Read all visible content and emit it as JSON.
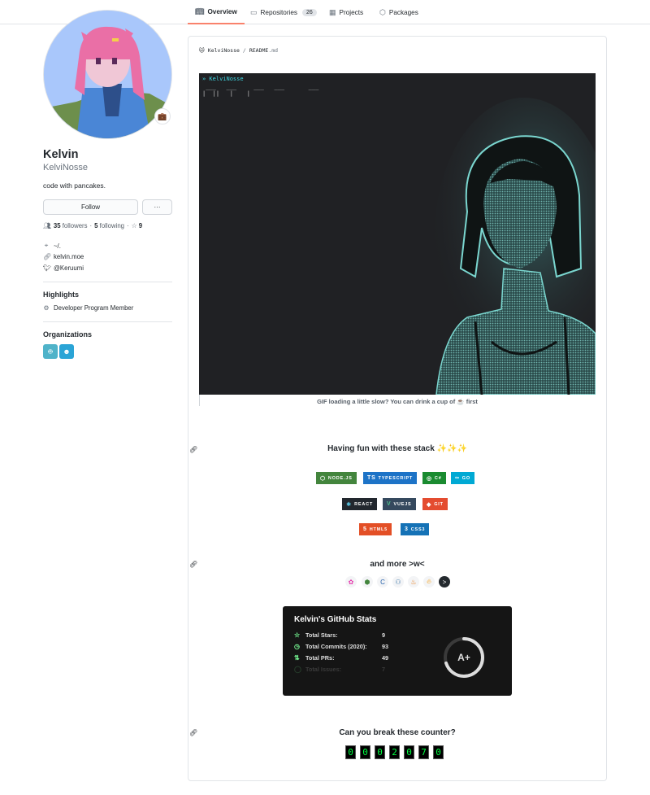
{
  "nav": {
    "tabs": [
      {
        "label": "Overview",
        "icon": "book-icon",
        "active": true
      },
      {
        "label": "Repositories",
        "icon": "repo-icon",
        "count": "26"
      },
      {
        "label": "Projects",
        "icon": "project-icon"
      },
      {
        "label": "Packages",
        "icon": "package-icon"
      }
    ]
  },
  "profile": {
    "name": "Kelvin",
    "login": "KelviNosse",
    "bio": "code with pancakes.",
    "follow_label": "Follow",
    "more_label": "···",
    "followers_count": "35",
    "followers_label": "followers",
    "following_count": "5",
    "following_label": "following",
    "stars_count": "9",
    "location": "~/.",
    "website": "kelvin.moe",
    "twitter": "@Keruumi",
    "status_icon": "briefcase-emoji"
  },
  "highlights": {
    "title": "Highlights",
    "items": [
      {
        "label": "Developer Program Member",
        "icon": "cpu-icon"
      }
    ]
  },
  "organizations": {
    "title": "Organizations",
    "items": [
      {
        "icon": "robot-org-icon",
        "color": "#4fb3c9"
      },
      {
        "icon": "face-org-icon",
        "color": "#2aa4d6"
      }
    ]
  },
  "readme": {
    "path_owner": "KelviNosse",
    "path_sep": "/",
    "path_file": "README",
    "path_ext": ".md",
    "terminal_title": "» KelviNosse",
    "terminal_art": " ___   ___     ___   ___       ___\n|  ||   |    |",
    "caption": "GIF loading a little slow? You can drink a cup of ☕ first",
    "section_stack_title": "Having fun with these stack ✨✨✨",
    "section_more_title": "and more >w<",
    "section_counter_title": "Can you break these counter?",
    "badges": [
      {
        "label": "NODE.JS",
        "color": "#43853d",
        "icon": "nodejs-icon",
        "glyph": "⬡"
      },
      {
        "label": "TYPESCRIPT",
        "color": "#1d73c7",
        "icon": "typescript-icon",
        "glyph": "TS"
      },
      {
        "label": "C#",
        "color": "#1a8b30",
        "icon": "csharp-icon",
        "glyph": "◎"
      },
      {
        "label": "GO",
        "color": "#00a9d4",
        "icon": "go-icon",
        "glyph": "∞"
      },
      {
        "label": "REACT",
        "color": "#22272e",
        "icon": "react-icon",
        "glyph": "⚛"
      },
      {
        "label": "VUEJS",
        "color": "#35495e",
        "icon": "vue-icon",
        "glyph": "V"
      },
      {
        "label": "GIT",
        "color": "#e44c30",
        "icon": "git-icon",
        "glyph": "◆"
      },
      {
        "label": "HTML5",
        "color": "#e34f26",
        "icon": "html5-icon",
        "glyph": "5"
      },
      {
        "label": "CSS3",
        "color": "#1572b6",
        "icon": "css3-icon",
        "glyph": "3"
      }
    ],
    "tech_icons": [
      "graphql-icon",
      "nodejs-icon",
      "c-lang-icon",
      "python-icon",
      "java-icon",
      "firebase-icon",
      "terminal-icon"
    ],
    "stats_card": {
      "title": "Kelvin's GitHub Stats",
      "rows": [
        {
          "label": "Total Stars:",
          "value": "9",
          "icon": "star-icon"
        },
        {
          "label": "Total Commits (2020):",
          "value": "93",
          "icon": "history-icon"
        },
        {
          "label": "Total PRs:",
          "value": "49",
          "icon": "pr-icon"
        },
        {
          "label": "Total Issues:",
          "value": "7",
          "icon": "issue-icon"
        }
      ],
      "rank": "A+",
      "rank_progress": 0.7
    },
    "counter_digits": [
      "0",
      "0",
      "0",
      "2",
      "0",
      "7",
      "0"
    ]
  }
}
